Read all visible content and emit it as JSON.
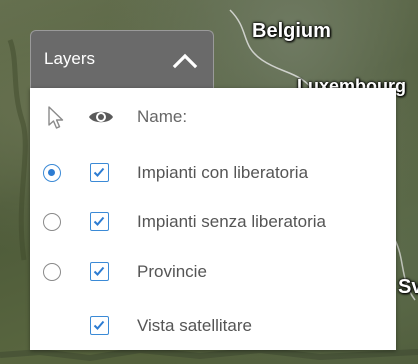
{
  "map": {
    "labels": {
      "country_1": "Belgium",
      "country_2": "Luxembourg",
      "partial": "Sv"
    }
  },
  "layers_panel": {
    "title": "Layers",
    "collapse_icon": "chevron-up-icon",
    "header": {
      "select_icon": "cursor-icon",
      "visibility_icon": "eye-icon",
      "name_label": "Name:"
    },
    "rows": [
      {
        "label": "Impianti con liberatoria",
        "has_radio": true,
        "radio_selected": true,
        "checked": true
      },
      {
        "label": "Impianti senza liberatoria",
        "has_radio": true,
        "radio_selected": false,
        "checked": true
      },
      {
        "label": "Provincie",
        "has_radio": true,
        "radio_selected": false,
        "checked": true
      },
      {
        "label": "Vista satellitare",
        "has_radio": false,
        "radio_selected": false,
        "checked": true
      }
    ]
  },
  "colors": {
    "accent": "#2d7cd2",
    "header_bg": "#6a6a6a",
    "text": "#555555"
  }
}
